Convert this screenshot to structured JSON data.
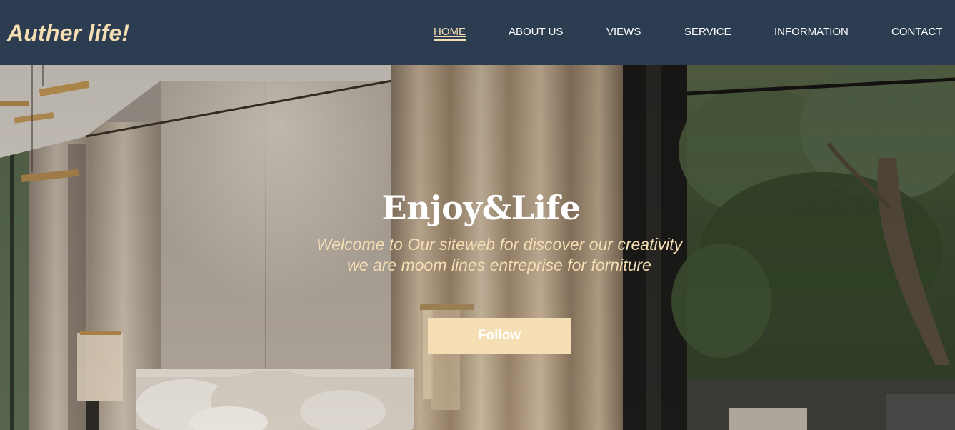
{
  "header": {
    "logo": "Auther life!",
    "nav": [
      {
        "label": "HOME",
        "active": true
      },
      {
        "label": "ABOUT US",
        "active": false
      },
      {
        "label": "VIEWS",
        "active": false
      },
      {
        "label": "SERVICE",
        "active": false
      },
      {
        "label": "INFORMATION",
        "active": false
      },
      {
        "label": "CONTACT",
        "active": false
      }
    ]
  },
  "hero": {
    "title": "Enjoy&Life",
    "subtitle_line1": "Welcome to Our siteweb for discover our creativity",
    "subtitle_line2": "we are moom lines entreprise for forniture",
    "button_label": "Follow",
    "image": "bedroom-interior-with-curtains-and-garden-view"
  },
  "colors": {
    "navbar": "#2c3c51",
    "accent": "#f5deb3",
    "nav_text": "#ffffff"
  }
}
